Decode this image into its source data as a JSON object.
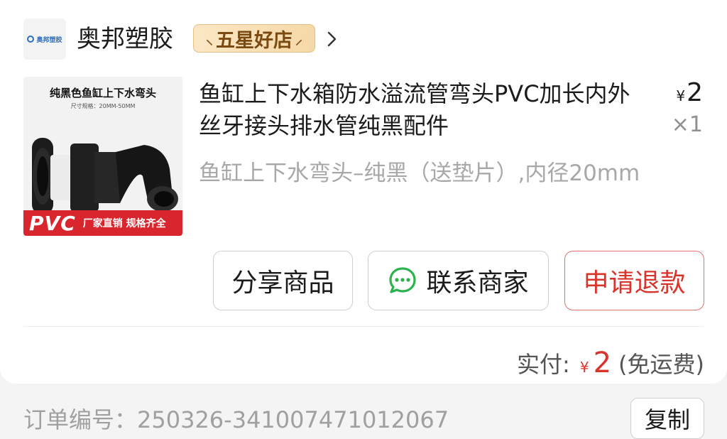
{
  "store": {
    "logo_text": "奥邦塑胶",
    "name": "奥邦塑胶",
    "badge_label": "五星好店",
    "badge_deco_left": "⸜",
    "badge_deco_right": "⸝"
  },
  "product": {
    "image": {
      "title": "纯黑色鱼缸上下水弯头",
      "spec": "尺寸规格：20MM-50MM",
      "band_pvc": "PVC",
      "band_slogan": "厂家直销 规格齐全"
    },
    "title": "鱼缸上下水箱防水溢流管弯头PVC加长内外丝牙接头排水管纯黑配件",
    "spec": "鱼缸上下水弯头–纯黑（送垫片）,内径20mm",
    "price_symbol": "¥",
    "price": "2",
    "qty": "×1"
  },
  "actions": {
    "share": "分享商品",
    "contact": "联系商家",
    "refund": "申请退款"
  },
  "total": {
    "label": "实付:",
    "symbol": "¥",
    "amount": "2",
    "note": "(免运费)"
  },
  "order": {
    "label": "订单编号：250326-341007471012067",
    "copy": "复制"
  },
  "colors": {
    "accent_red": "#d9342b",
    "badge_gold": "#f5d9a8",
    "chat_green": "#2bb24c"
  },
  "icons": {
    "chevron": "chevron-right-icon",
    "chat": "chat-bubble-icon"
  }
}
